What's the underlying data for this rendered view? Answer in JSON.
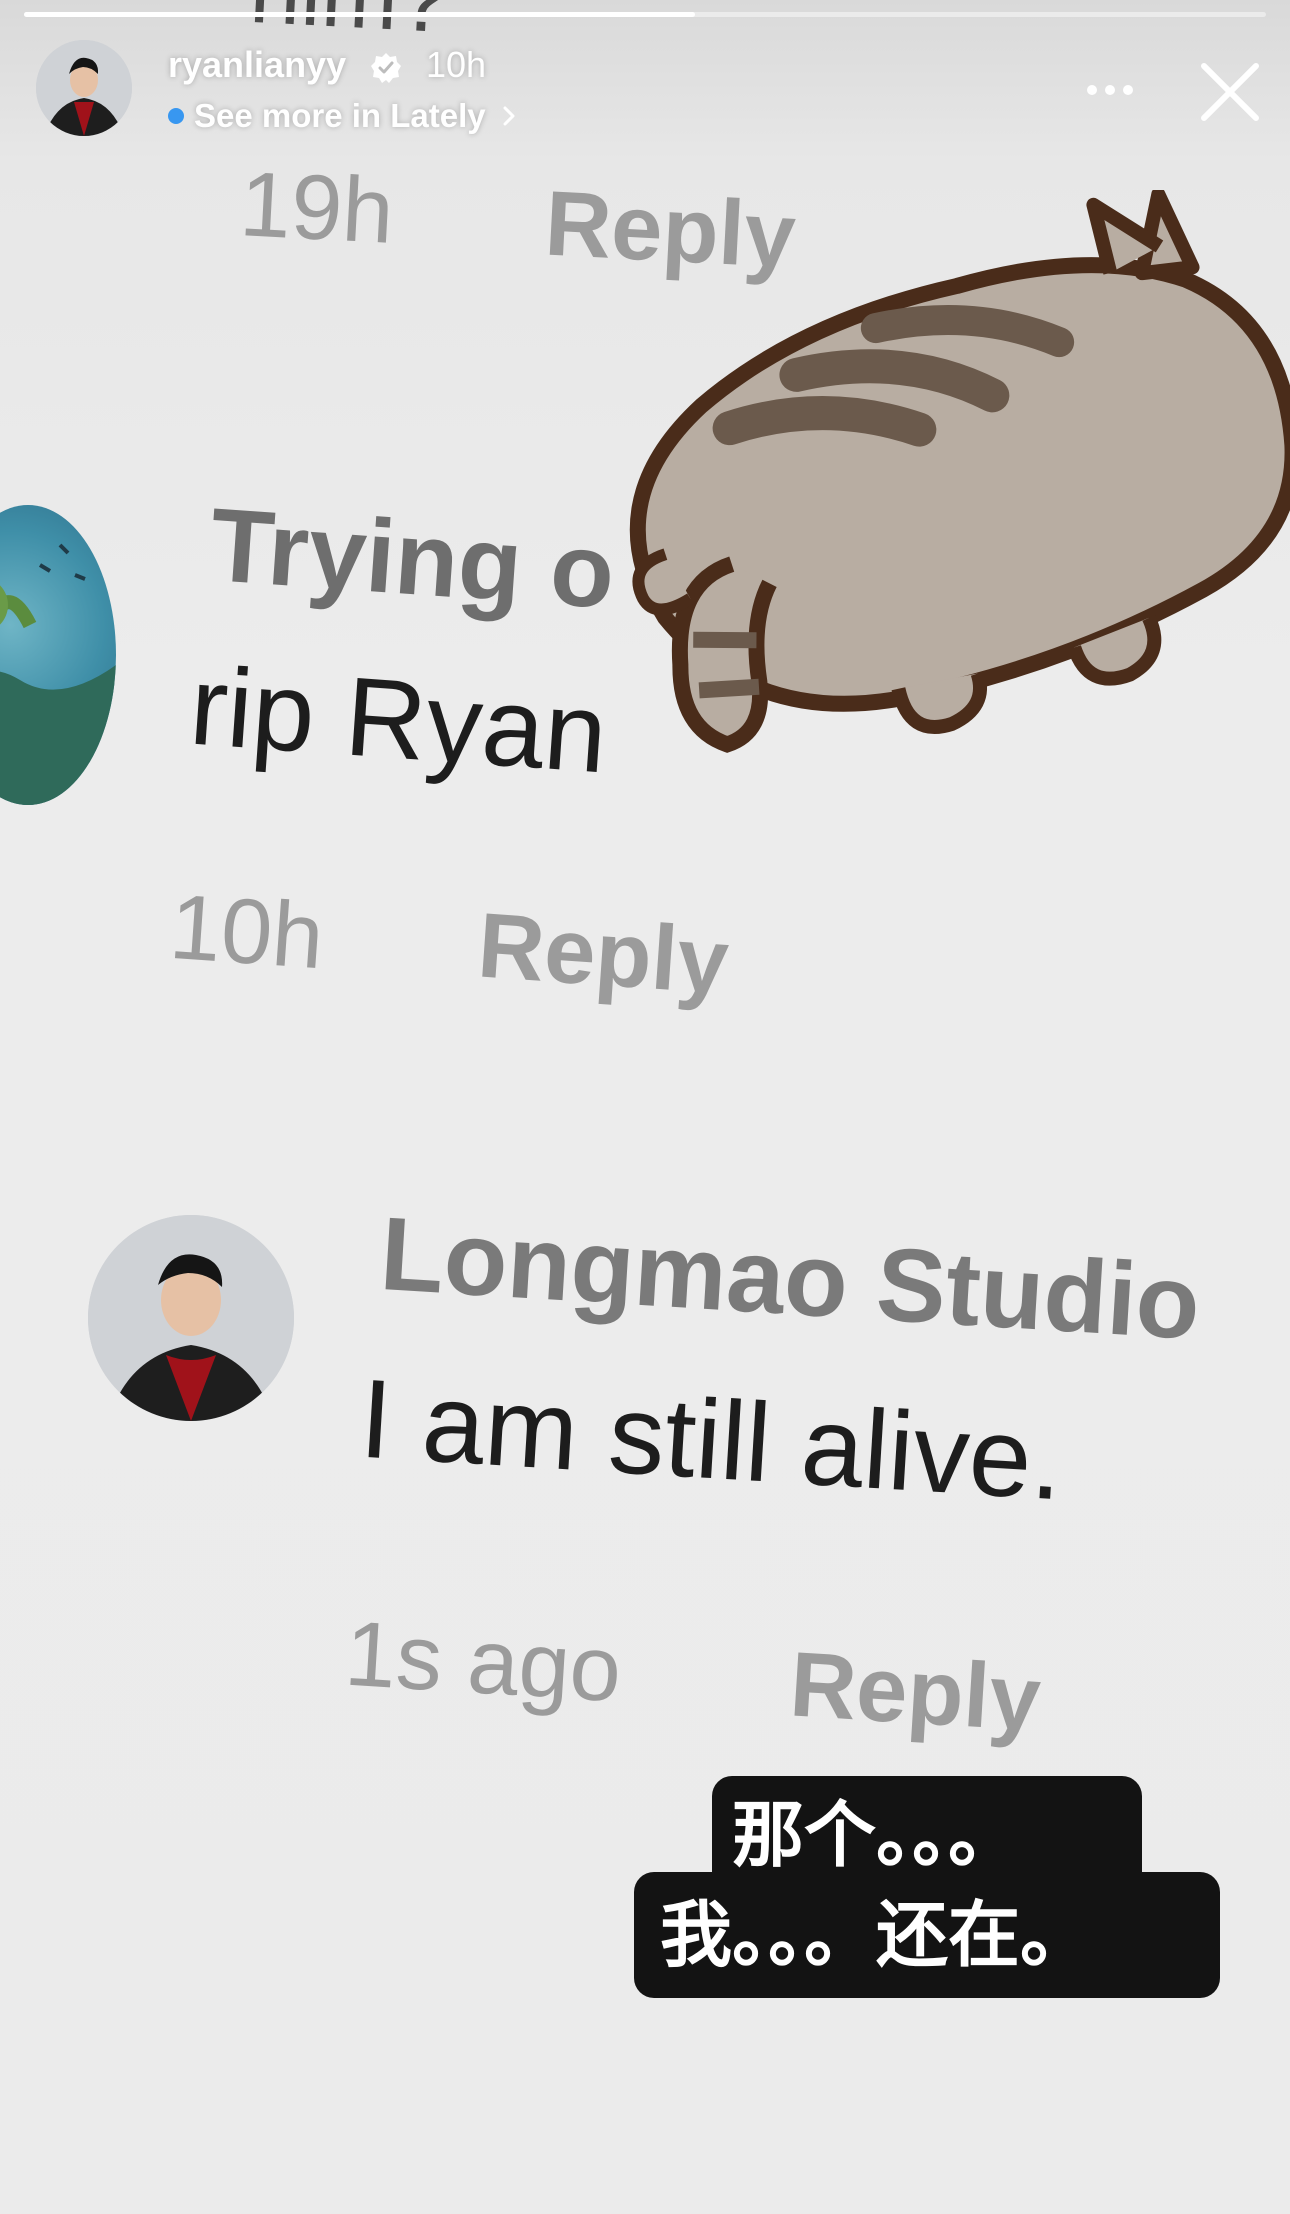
{
  "story": {
    "username": "ryanlianyy",
    "timestamp": "10h",
    "lately_link": "See more in Lately",
    "progress": 0.54
  },
  "screenshot": {
    "cut_top_text": "him?",
    "first_meta": {
      "time": "19h",
      "reply": "Reply"
    },
    "comment1": {
      "name": "Trying o",
      "text": "rip Ryan",
      "time": "10h",
      "reply": "Reply"
    },
    "comment2": {
      "name": "Longmao Studio",
      "text": "I am still alive.",
      "time": "1s ago",
      "reply": "Reply"
    }
  },
  "caption": {
    "line1": "那个。。。",
    "line2": "我。。。还在。"
  },
  "colors": {
    "background": "#ebebeb",
    "caption_bg": "#131313",
    "caption_text": "#ffffff",
    "accent_dot": "#3897f0"
  }
}
